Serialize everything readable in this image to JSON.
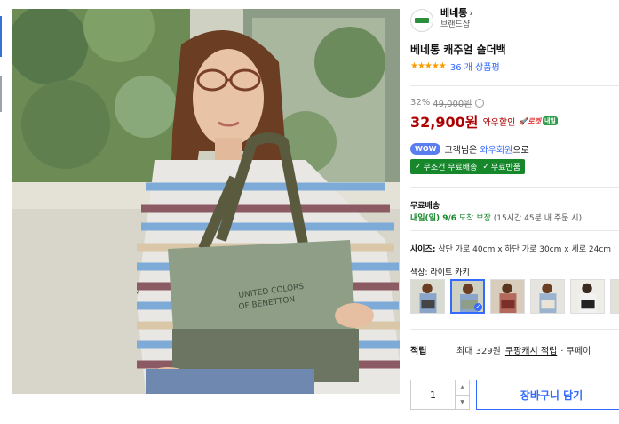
{
  "brand": {
    "name": "베네통",
    "chevron": "›",
    "subtitle": "브랜드샵",
    "logo_icon": "brand-logo-icon"
  },
  "product": {
    "title": "베네통 캐주얼 숄더백",
    "rating_stars": "★★★★★",
    "review_count": "36 개 상품평",
    "rating": 5
  },
  "price": {
    "discount_rate": "32%",
    "original_price": "49,000원",
    "info_icon": "i",
    "sale_price": "32,900원",
    "sale_label": "와우할인",
    "rocket_label": "🚀로켓",
    "rocket_sub": "내일"
  },
  "membership": {
    "badge": "WOW",
    "text_prefix": "고객님은",
    "member_link": "와우회원",
    "text_suffix": "으로",
    "benefits": [
      "무조건 무료배송",
      "무료반품"
    ],
    "check_icon": "✓"
  },
  "shipping": {
    "title": "무료배송",
    "eta_date": "내일(일) 9/6",
    "eta_guarantee": "도착 보장",
    "eta_condition": "(15시간 45분 내 주문 시)"
  },
  "size": {
    "label": "사이즈:",
    "value": "상단 가로 40cm x 하단 가로 30cm x 세로 24cm"
  },
  "color": {
    "label": "색상:",
    "value": "라이트 카키",
    "swatch_count": 6,
    "selected_index": 1
  },
  "points": {
    "label": "적립",
    "max": "최대 329원",
    "link": "쿠팡캐시 적립",
    "more": "· 쿠페이"
  },
  "purchase": {
    "quantity": "1",
    "step_up": "▲",
    "step_down": "▼",
    "cart_button": "장바구니 담기"
  },
  "colors": {
    "accent": "#346aff",
    "sale": "#ae0000",
    "green": "#16872b",
    "star": "#ff9c00"
  }
}
